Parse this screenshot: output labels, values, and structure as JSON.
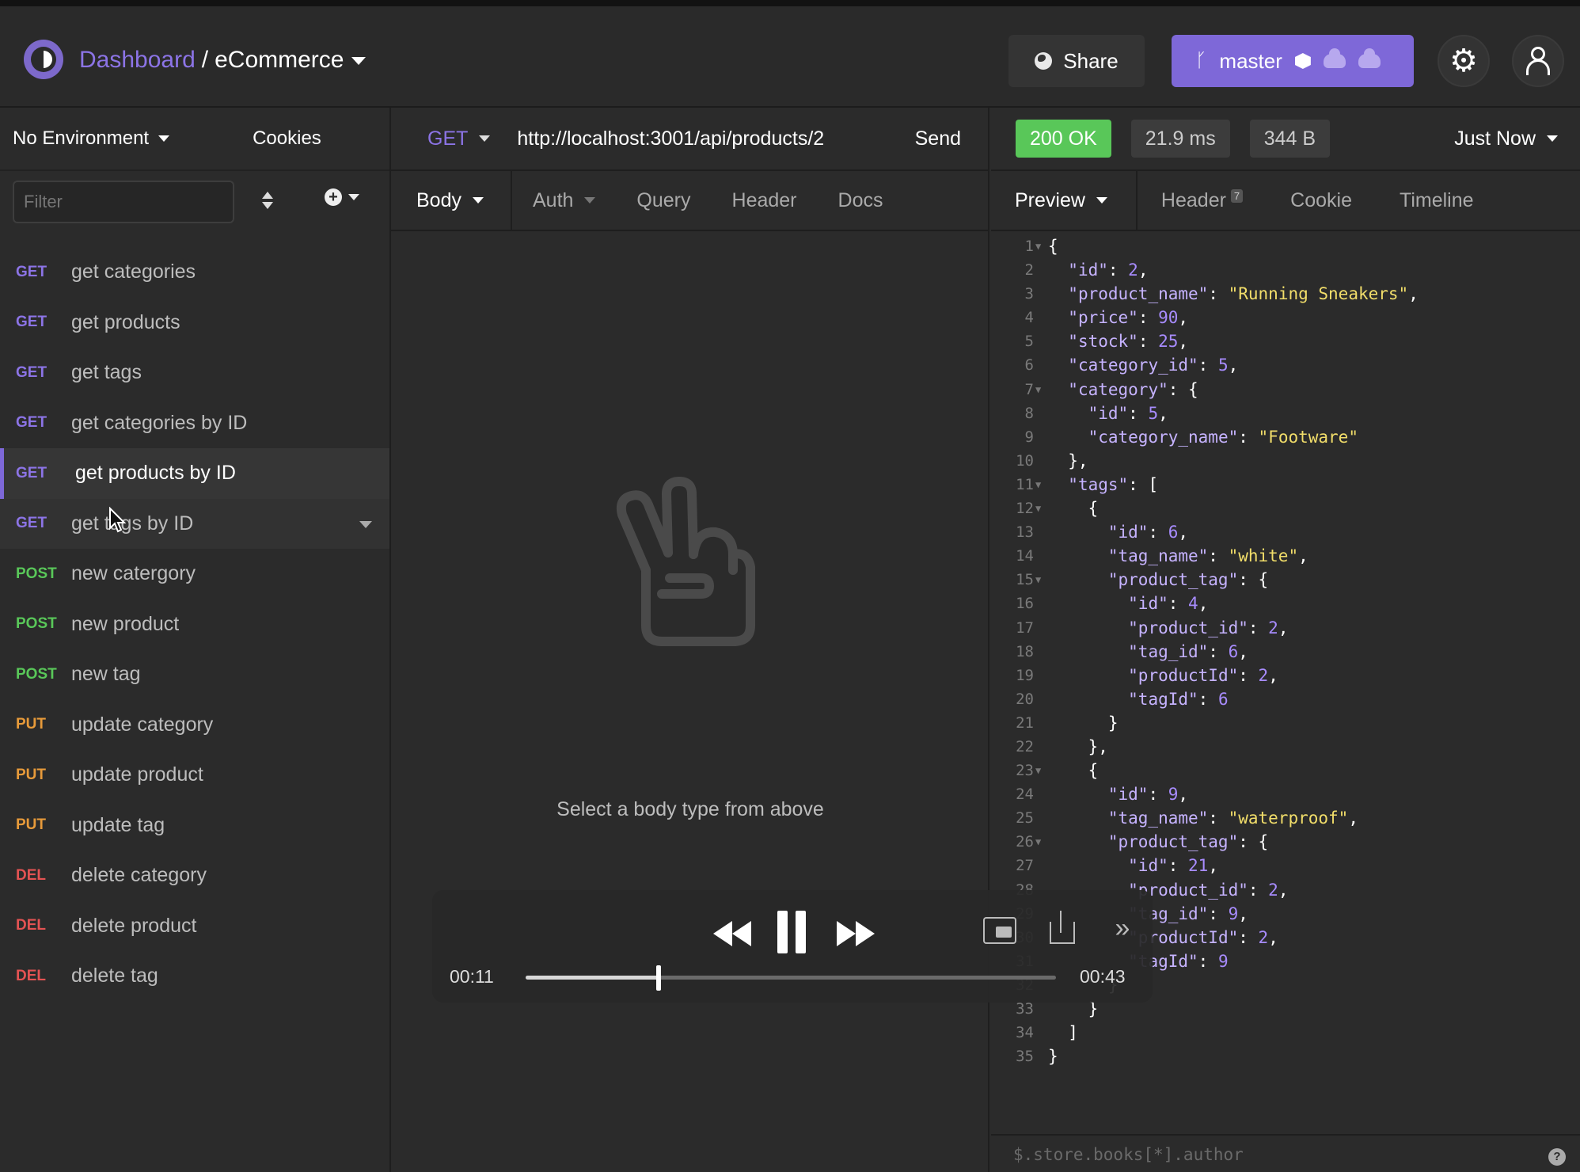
{
  "header": {
    "dashboard": "Dashboard",
    "separator": "/",
    "project": "eCommerce",
    "share_label": "Share",
    "branch_label": "master"
  },
  "sidebar": {
    "environment": "No Environment",
    "cookies": "Cookies",
    "filter_placeholder": "Filter",
    "requests": [
      {
        "method": "GET",
        "name": "get categories"
      },
      {
        "method": "GET",
        "name": "get products"
      },
      {
        "method": "GET",
        "name": "get tags"
      },
      {
        "method": "GET",
        "name": "get categories by ID"
      },
      {
        "method": "GET",
        "name": "get products by ID"
      },
      {
        "method": "GET",
        "name": "get tags by ID"
      },
      {
        "method": "POST",
        "name": "new catergory"
      },
      {
        "method": "POST",
        "name": "new product"
      },
      {
        "method": "POST",
        "name": "new tag"
      },
      {
        "method": "PUT",
        "name": "update category"
      },
      {
        "method": "PUT",
        "name": "update product"
      },
      {
        "method": "PUT",
        "name": "update tag"
      },
      {
        "method": "DEL",
        "name": "delete category"
      },
      {
        "method": "DEL",
        "name": "delete product"
      },
      {
        "method": "DEL",
        "name": "delete tag"
      }
    ]
  },
  "request": {
    "method": "GET",
    "url": "http://localhost:3001/api/products/2",
    "send_label": "Send",
    "tabs": [
      "Body",
      "Auth",
      "Query",
      "Header",
      "Docs"
    ],
    "empty_message": "Select a body type from above"
  },
  "response": {
    "status": "200 OK",
    "time": "21.9 ms",
    "size": "344 B",
    "when": "Just Now",
    "tabs": [
      "Preview",
      "Header",
      "Cookie",
      "Timeline"
    ],
    "header_count": "7",
    "jq_placeholder": "$.store.books[*].author",
    "lines": [
      {
        "n": "1",
        "fold": true,
        "t": "{"
      },
      {
        "n": "2",
        "t": "  \"id\": 2,"
      },
      {
        "n": "3",
        "t": "  \"product_name\": \"Running Sneakers\","
      },
      {
        "n": "4",
        "t": "  \"price\": 90,"
      },
      {
        "n": "5",
        "t": "  \"stock\": 25,"
      },
      {
        "n": "6",
        "t": "  \"category_id\": 5,"
      },
      {
        "n": "7",
        "fold": true,
        "t": "  \"category\": {"
      },
      {
        "n": "8",
        "t": "    \"id\": 5,"
      },
      {
        "n": "9",
        "t": "    \"category_name\": \"Footware\""
      },
      {
        "n": "10",
        "t": "  },"
      },
      {
        "n": "11",
        "fold": true,
        "t": "  \"tags\": ["
      },
      {
        "n": "12",
        "fold": true,
        "t": "    {"
      },
      {
        "n": "13",
        "t": "      \"id\": 6,"
      },
      {
        "n": "14",
        "t": "      \"tag_name\": \"white\","
      },
      {
        "n": "15",
        "fold": true,
        "t": "      \"product_tag\": {"
      },
      {
        "n": "16",
        "t": "        \"id\": 4,"
      },
      {
        "n": "17",
        "t": "        \"product_id\": 2,"
      },
      {
        "n": "18",
        "t": "        \"tag_id\": 6,"
      },
      {
        "n": "19",
        "t": "        \"productId\": 2,"
      },
      {
        "n": "20",
        "t": "        \"tagId\": 6"
      },
      {
        "n": "21",
        "t": "      }"
      },
      {
        "n": "22",
        "t": "    },"
      },
      {
        "n": "23",
        "fold": true,
        "t": "    {"
      },
      {
        "n": "24",
        "t": "      \"id\": 9,"
      },
      {
        "n": "25",
        "t": "      \"tag_name\": \"waterproof\","
      },
      {
        "n": "26",
        "fold": true,
        "t": "      \"product_tag\": {"
      },
      {
        "n": "27",
        "t": "        \"id\": 21,"
      },
      {
        "n": "28",
        "t": "        \"product_id\": 2,"
      },
      {
        "n": "29",
        "t": "        \"tag_id\": 9,"
      },
      {
        "n": "30",
        "t": "        \"productId\": 2,"
      },
      {
        "n": "31",
        "t": "        \"tagId\": 9"
      },
      {
        "n": "32",
        "t": "      }"
      },
      {
        "n": "33",
        "t": "    }"
      },
      {
        "n": "34",
        "t": "  ]"
      },
      {
        "n": "35",
        "t": "}"
      }
    ]
  },
  "player": {
    "current_time": "00:11",
    "total_time": "00:43",
    "progress": 0.25
  }
}
